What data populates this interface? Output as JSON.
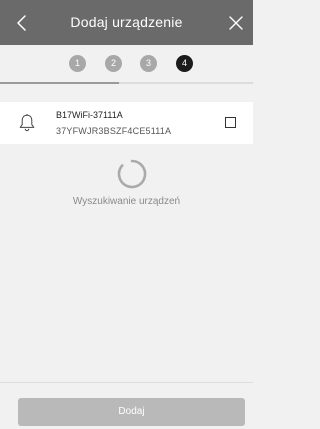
{
  "header": {
    "title": "Dodaj urządzenie"
  },
  "steps": {
    "labels": [
      "1",
      "2",
      "3",
      "4"
    ],
    "active_index": 3
  },
  "progress": {
    "fraction": 0.47
  },
  "device": {
    "name": "B17WiFi-37111A",
    "serial": "37YFWJR3BSZF4CE5111A",
    "checked": false
  },
  "status": {
    "searching_text": "Wyszukiwanie urządzeń"
  },
  "footer": {
    "add_label": "Dodaj"
  },
  "colors": {
    "header_bg": "#6a6a6a",
    "step_inactive": "#a8a8a8",
    "step_active": "#1b1b1b",
    "button_disabled": "#b9b9b9"
  }
}
